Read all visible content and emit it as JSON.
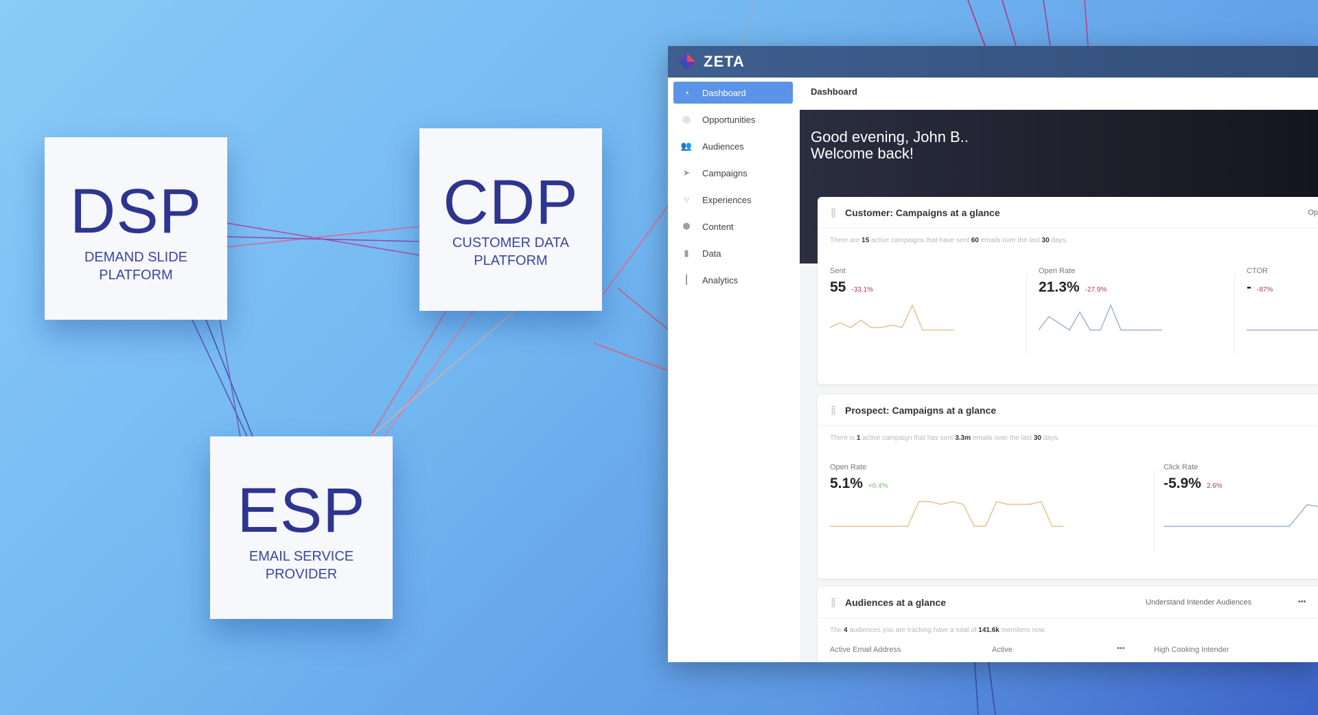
{
  "boxes": [
    {
      "title": "DSP",
      "subtitle_1": "DEMAND SLIDE",
      "subtitle_2": "PLATFORM"
    },
    {
      "title": "CDP",
      "subtitle_1": "CUSTOMER DATA",
      "subtitle_2": "PLATFORM"
    },
    {
      "title": "ESP",
      "subtitle_1": "EMAIL SERVICE",
      "subtitle_2": "PROVIDER"
    }
  ],
  "app": {
    "brand": "ZETA",
    "sidebar": {
      "items": [
        {
          "label": "Dashboard",
          "icon": "gauge-icon",
          "active": true
        },
        {
          "label": "Opportunities",
          "icon": "target-icon"
        },
        {
          "label": "Audiences",
          "icon": "users-icon"
        },
        {
          "label": "Campaigns",
          "icon": "paper-plane-icon"
        },
        {
          "label": "Experiences",
          "icon": "hierarchy-icon"
        },
        {
          "label": "Content",
          "icon": "cube-icon"
        },
        {
          "label": "Data",
          "icon": "files-icon"
        },
        {
          "label": "Analytics",
          "icon": "bar-chart-icon"
        }
      ]
    },
    "breadcrumb": "Dashboard",
    "greeting_1": "Good evening, John B..",
    "greeting_2": "Welcome back!",
    "customer_card": {
      "title": "Customer: Campaigns at a glance",
      "right_link": "Op",
      "summary": {
        "p1": "There are ",
        "v1": "15",
        "p2": " active campaigns that have sent ",
        "v2": "60",
        "p3": " emails over the last ",
        "v3": "30",
        "p4": " days."
      },
      "metrics": [
        {
          "label": "Sent",
          "value": "55",
          "delta": "-33.1%",
          "color": "#e0c48a",
          "spark": [
            1,
            3,
            1,
            4,
            1,
            1,
            2,
            1,
            10,
            0,
            0,
            0,
            0
          ]
        },
        {
          "label": "Open Rate",
          "value": "21.3%",
          "delta": "-27.9%",
          "color": "#9fb4d2",
          "spark": [
            0,
            6,
            3,
            0,
            8,
            0,
            0,
            11,
            0,
            0,
            0,
            0,
            0
          ]
        },
        {
          "label": "CTOR",
          "value": "-",
          "delta": "-87%",
          "color": "#9fb4d2",
          "spark": [
            0,
            0,
            0
          ]
        }
      ]
    },
    "prospect_card": {
      "title": "Prospect: Campaigns at a glance",
      "summary": {
        "p1": "There is ",
        "v1": "1",
        "p2": " active campaign that has sent ",
        "v2": "3.3m",
        "p3": " emails over the last ",
        "v3": "30",
        "p4": " days."
      },
      "metrics": [
        {
          "label": "Open Rate",
          "value": "5.1%",
          "delta": "+0.4%",
          "delta_type": "pos",
          "color": "#e0c48a",
          "spark": [
            0,
            0,
            0,
            0,
            0,
            0,
            0,
            0,
            9,
            9,
            8,
            9,
            8,
            0,
            0,
            9,
            8,
            8,
            8,
            9,
            0,
            0
          ]
        },
        {
          "label": "Click Rate",
          "value": "-5.9%",
          "delta": "2.6%",
          "delta_type": "neg",
          "color": "#9fb4d2",
          "spark": [
            0,
            0,
            0,
            0,
            0,
            0,
            0,
            0,
            7,
            6,
            8,
            6,
            0,
            0
          ]
        }
      ]
    },
    "audiences_card": {
      "title": "Audiences at a glance",
      "right_link": "Understand Intender Audiences",
      "more": "•••",
      "summary": {
        "p1": "The ",
        "v1": "4",
        "p2": " audiences you are tracking have a total of ",
        "v2": "141.6k",
        "p3": " members now."
      },
      "columns": [
        "Active Email Address",
        "Active",
        "High Cooking Intender"
      ],
      "col_more": "•••"
    }
  }
}
